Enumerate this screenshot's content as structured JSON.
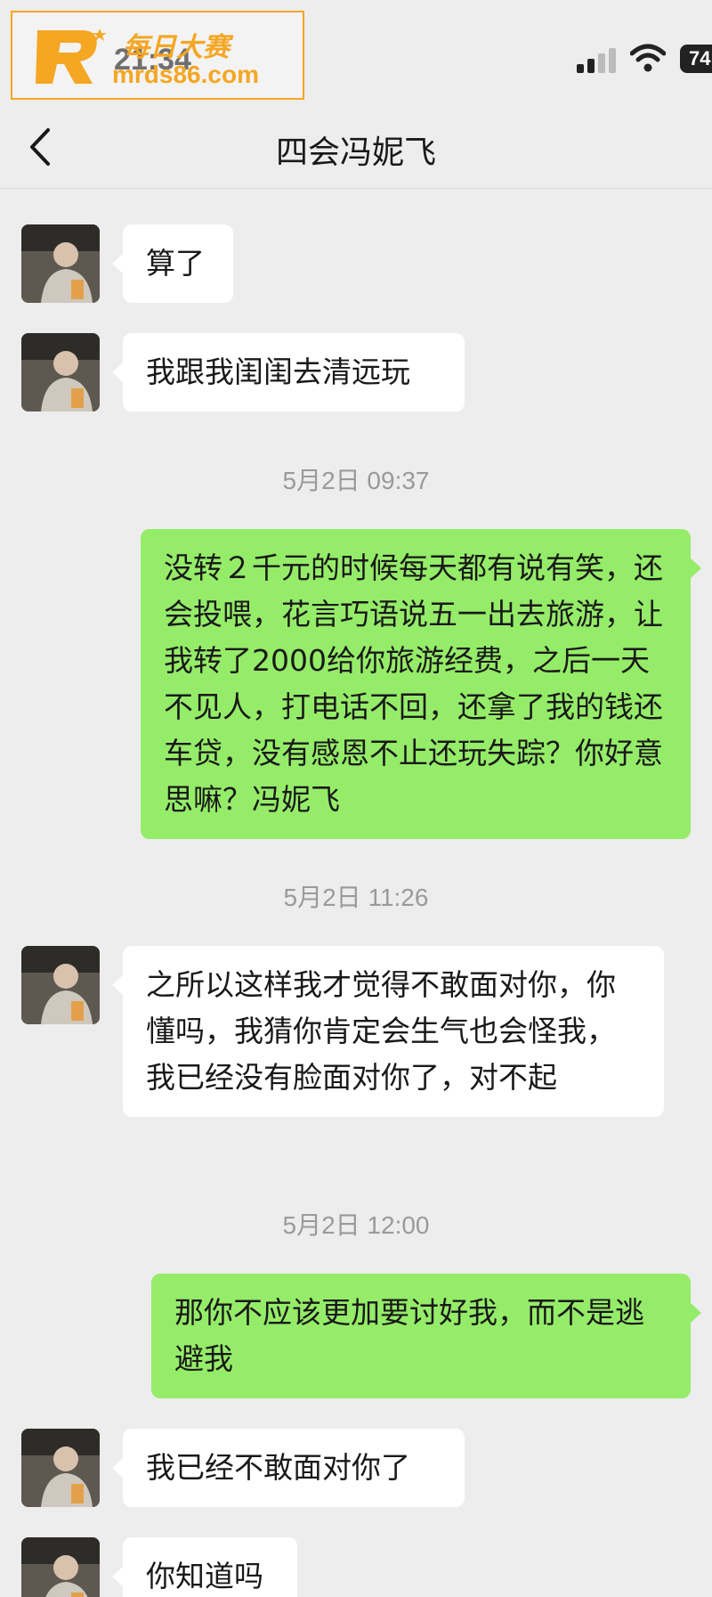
{
  "status_bar": {
    "time": "21:34",
    "battery": "74"
  },
  "watermark": {
    "line1": "每日大赛",
    "line2": "mrds86.com"
  },
  "header": {
    "title": "四会冯妮飞"
  },
  "messages": [
    {
      "side": "left",
      "text": "算了"
    },
    {
      "side": "left",
      "text": "我跟我闺闺去清远玩"
    },
    {
      "timestamp": "5月2日 09:37"
    },
    {
      "side": "right",
      "text": "没转２千元的时候每天都有说有笑，还会投喂，花言巧语说五一出去旅游，让我转了2000给你旅游经费，之后一天不见人，打电话不回，还拿了我的钱还车贷，没有感恩不止还玩失踪？你好意思嘛？冯妮飞"
    },
    {
      "timestamp": "5月2日 11:26"
    },
    {
      "side": "left",
      "text": "之所以这样我才觉得不敢面对你，你懂吗，我猜你肯定会生气也会怪我，我已经没有脸面对你了，对不起"
    },
    {
      "timestamp": "5月2日 12:00"
    },
    {
      "side": "right",
      "text": "那你不应该更加要讨好我，而不是逃避我"
    },
    {
      "side": "left",
      "text": "我已经不敢面对你了"
    },
    {
      "side": "left",
      "text": "你知道吗"
    }
  ],
  "colors": {
    "background": "#ededed",
    "incoming_bubble": "#ffffff",
    "outgoing_bubble": "#95ec69",
    "watermark": "#f5a623"
  },
  "icons": [
    "back-arrow-icon",
    "signal-icon",
    "wifi-icon",
    "battery-icon",
    "avatar"
  ]
}
